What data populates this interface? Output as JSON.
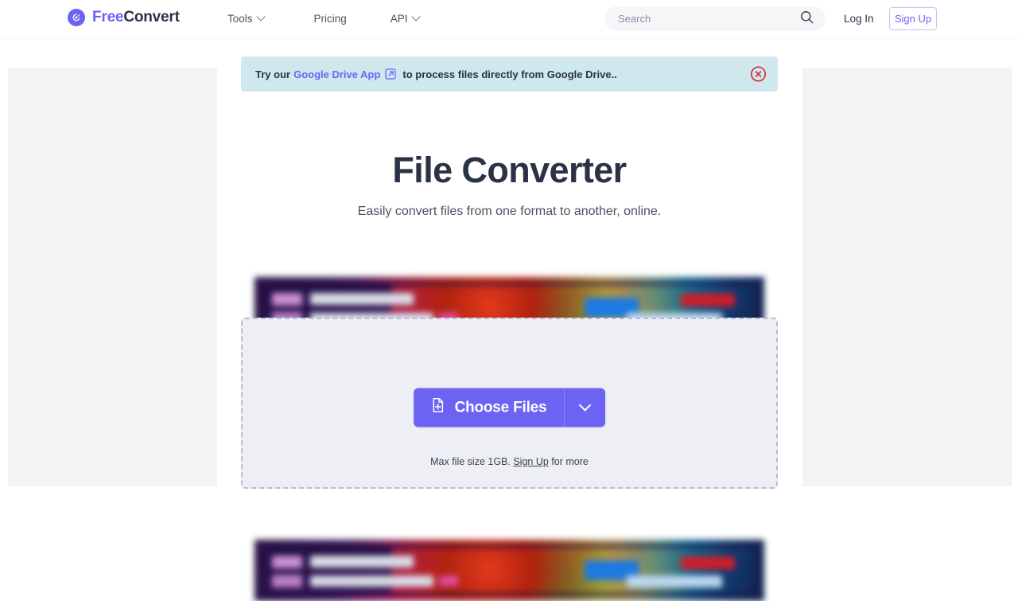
{
  "navbar": {
    "brand": {
      "free": "Free",
      "convert": "Convert",
      "icon": "refresh-circle-icon"
    },
    "links": [
      {
        "label": "Tools",
        "has_caret": true
      },
      {
        "label": "Pricing",
        "has_caret": false
      },
      {
        "label": "API",
        "has_caret": true
      }
    ],
    "search": {
      "placeholder": "Search",
      "value": "",
      "icon": "search-icon"
    },
    "login_label": "Log In",
    "signup_label": "Sign Up"
  },
  "banner": {
    "lead": "Try our",
    "link": "Google Drive App",
    "link_icon": "external-link-icon",
    "tail": "to process files directly from Google Drive..",
    "close_icon": "close-circle-icon",
    "background": "#cfe8ee"
  },
  "hero": {
    "title": "File Converter",
    "subtitle": "Easily convert files from one format to another, online."
  },
  "dropzone": {
    "choose_files_label": "Choose Files",
    "file_icon": "file-plus-icon",
    "caret_icon": "chevron-down-icon",
    "max_size_prefix": "Max file size 1GB.",
    "max_size_link": "Sign Up",
    "max_size_suffix": "for more"
  },
  "ads": {
    "left_rail": "ad-placeholder",
    "right_rail": "ad-placeholder",
    "top_banner": "blurred-ad-creative",
    "bottom_banner": "blurred-ad-creative"
  },
  "colors": {
    "brand_purple": "#6c63f5",
    "dark_navy": "#2b3245",
    "banner_teal": "#cfe8ee",
    "close_red": "#d8232a",
    "dropzone_bg": "#eeeff4",
    "dropzone_border": "#b9bdd6"
  }
}
